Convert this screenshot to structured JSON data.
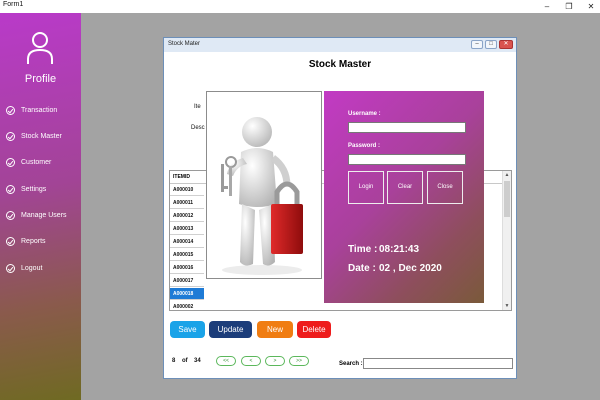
{
  "window": {
    "title": "Form1",
    "minimize": "–",
    "restore": "❐",
    "close": "✕"
  },
  "sidebar": {
    "profile_label": "Profile",
    "items": [
      {
        "label": "Transaction",
        "icon": "check-circle-icon"
      },
      {
        "label": "Stock Master",
        "icon": "check-circle-icon"
      },
      {
        "label": "Customer",
        "icon": "check-circle-icon"
      },
      {
        "label": "Settings",
        "icon": "check-circle-icon"
      },
      {
        "label": "Manage Users",
        "icon": "check-circle-icon"
      },
      {
        "label": "Reports",
        "icon": "check-circle-icon"
      },
      {
        "label": "Logout",
        "icon": "check-circle-icon"
      }
    ]
  },
  "stock": {
    "caption": "Stock Mater",
    "heading": "Stock Master",
    "label_item": "Ite",
    "label_desc": "Desc",
    "grid": {
      "column": "ITEMID",
      "rows": [
        "A000010",
        "A000011",
        "A000012",
        "A000013",
        "A000014",
        "A000015",
        "A000016",
        "A000017",
        "A000018",
        "A000002"
      ],
      "selected_row": "A000018"
    },
    "login": {
      "username_label": "Username :",
      "username_value": "",
      "password_label": "Password :",
      "password_value": "",
      "login_button": "Login",
      "clear_button": "Clear",
      "close_button": "Close",
      "time_label": "Time :",
      "time_value": "08:21:43",
      "date_label": "Date :",
      "date_value": "02 , Dec 2020"
    },
    "actions": {
      "save": "Save",
      "update": "Update",
      "new": "New",
      "delete": "Delete"
    },
    "pager": {
      "current": "8",
      "of_label": "of",
      "total": "34",
      "first": "<<",
      "prev": "<",
      "next": ">",
      "last": ">>"
    },
    "search": {
      "label": "Search :",
      "value": ""
    }
  },
  "colors": {
    "save": "#1aa3e8",
    "update": "#1c3d7a",
    "new": "#f07d12",
    "delete": "#ee1c1c",
    "selected_row": "#1e7bd6"
  }
}
